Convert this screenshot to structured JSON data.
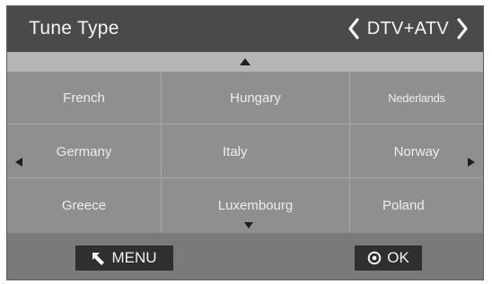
{
  "header": {
    "title": "Tune Type",
    "selector_value": "DTV+ATV",
    "prev_icon": "chevron-left-icon",
    "next_icon": "chevron-right-icon"
  },
  "countries": [
    [
      "French",
      "Hungary",
      "Nederlands"
    ],
    [
      "Germany",
      "Italy",
      "Norway"
    ],
    [
      "Greece",
      "Luxembourg",
      "Poland"
    ]
  ],
  "footer": {
    "menu_label": "MENU",
    "ok_label": "OK",
    "menu_icon": "back-arrow-icon",
    "ok_icon": "circle-dot-icon"
  },
  "colors": {
    "header_bg": "#4a4a4a",
    "grid_bg": "#8f8f8f",
    "footer_bg": "#7a7a7a",
    "button_bg": "#2f2f2f",
    "text": "#ededed"
  }
}
